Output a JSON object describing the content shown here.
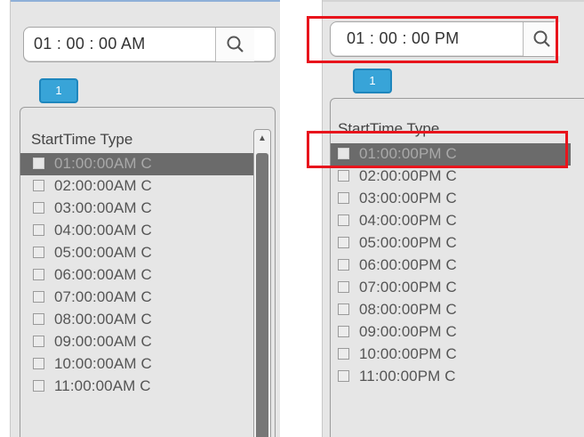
{
  "left_panel": {
    "time": "01 : 00 : 00 AM",
    "tab": "1",
    "header": "StartTime Type",
    "rows": [
      "01:00:00AM  C",
      "02:00:00AM  C",
      "03:00:00AM  C",
      "04:00:00AM  C",
      "05:00:00AM  C",
      "06:00:00AM  C",
      "07:00:00AM  C",
      "08:00:00AM  C",
      "09:00:00AM  C",
      "10:00:00AM  C",
      "11:00:00AM  C"
    ],
    "selected_index": 0,
    "scroll_up_icon": "triangle-up"
  },
  "right_panel": {
    "time": "01 : 00 : 00 PM",
    "tab": "1",
    "header": "StartTime Type",
    "rows": [
      "01:00:00PM  C",
      "02:00:00PM  C",
      "03:00:00PM  C",
      "04:00:00PM  C",
      "05:00:00PM  C",
      "06:00:00PM  C",
      "07:00:00PM  C",
      "08:00:00PM  C",
      "09:00:00PM  C",
      "10:00:00PM  C",
      "11:00:00PM  C"
    ],
    "selected_index": 0
  },
  "icons": {
    "search": "search-icon"
  },
  "colors": {
    "highlight": "#e8141c",
    "tab": "#38a4d8",
    "selected_row": "#6b6b6b",
    "panel_bg": "#e6e6e6"
  }
}
